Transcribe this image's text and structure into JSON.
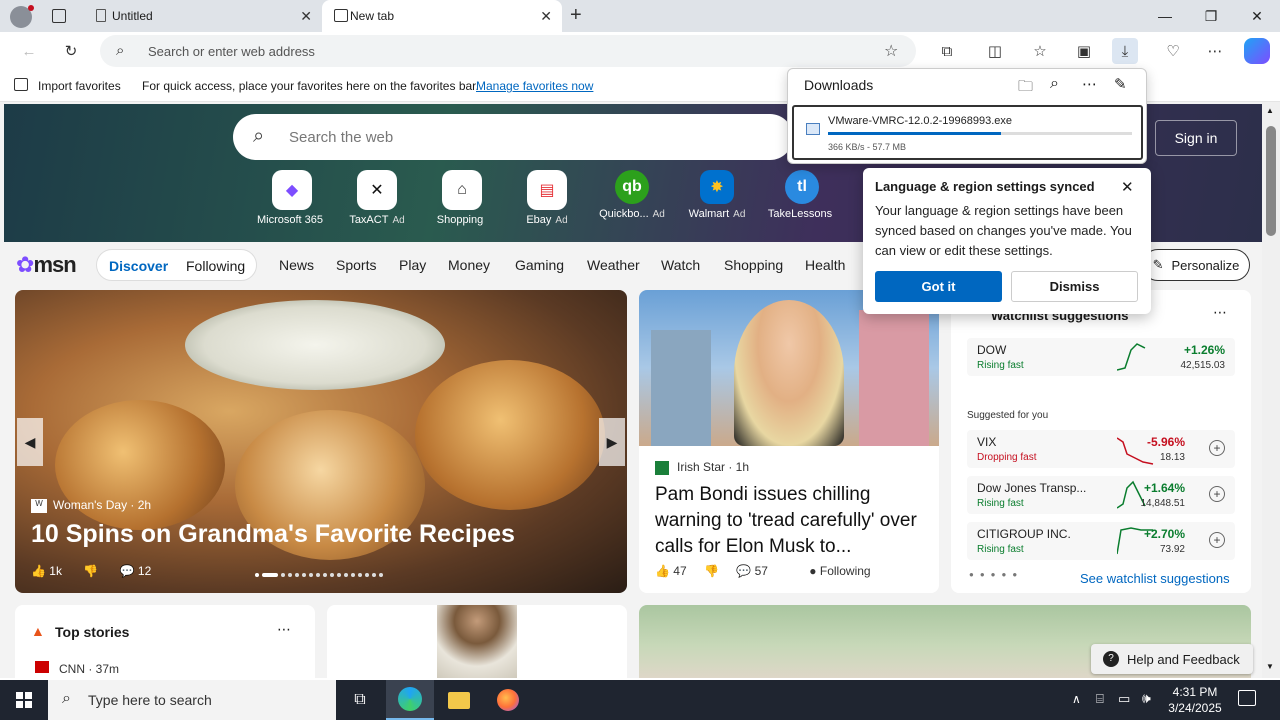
{
  "browser": {
    "tabs": [
      {
        "label": "Untitled"
      },
      {
        "label": "New tab"
      }
    ],
    "address_placeholder": "Search or enter web address",
    "favbar": {
      "import_label": "Import favorites",
      "message": "For quick access, place your favorites here on the favorites bar.",
      "manage_link": "Manage favorites now"
    }
  },
  "newtab": {
    "search_placeholder": "Search the web",
    "signin_label": "Sign in",
    "quick_links": [
      {
        "label": "Microsoft 365",
        "ad": ""
      },
      {
        "label": "TaxACT",
        "ad": "Ad"
      },
      {
        "label": "Shopping",
        "ad": ""
      },
      {
        "label": "Ebay",
        "ad": "Ad"
      },
      {
        "label": "Quickbo...",
        "ad": "Ad"
      },
      {
        "label": "Walmart",
        "ad": "Ad"
      },
      {
        "label": "TakeLessons",
        "ad": ""
      }
    ],
    "brand": "msn",
    "nav": {
      "discover": "Discover",
      "following": "Following",
      "items": [
        "News",
        "Sports",
        "Play",
        "Money",
        "Gaming",
        "Weather",
        "Watch",
        "Shopping",
        "Health"
      ],
      "personalize": "Personalize"
    },
    "hero": {
      "source": "Woman's Day · 2h",
      "title": "10 Spins on Grandma's Favorite Recipes",
      "likes": "1k",
      "comments": "12"
    },
    "news": {
      "source": "Irish Star · 1h",
      "title": "Pam Bondi issues chilling warning to 'tread carefully' over calls for Elon Musk to...",
      "likes": "47",
      "comments": "57",
      "following": "Following"
    },
    "watchlist": {
      "title": "Watchlist suggestions",
      "suggested_label": "Suggested for you",
      "see_more": "See watchlist suggestions",
      "stocks": [
        {
          "name": "DOW",
          "trend": "Rising fast",
          "pct": "+1.26%",
          "value": "42,515.03",
          "color": "#0a7d2e"
        },
        {
          "name": "VIX",
          "trend": "Dropping fast",
          "pct": "-5.96%",
          "value": "18.13",
          "color": "#c50f1f"
        },
        {
          "name": "Dow Jones Transp...",
          "trend": "Rising fast",
          "pct": "+1.64%",
          "value": "14,848.51",
          "color": "#0a7d2e"
        },
        {
          "name": "CITIGROUP INC.",
          "trend": "Rising fast",
          "pct": "+2.70%",
          "value": "73.92",
          "color": "#0a7d2e"
        }
      ]
    },
    "top_stories": {
      "title": "Top stories",
      "first_source": "CNN · 37m"
    },
    "help": "Help and Feedback"
  },
  "downloads": {
    "title": "Downloads",
    "file": "VMware-VMRC-12.0.2-19968993.exe",
    "status": "366 KB/s - 57.7 MB",
    "progress": 0.57
  },
  "lang_popup": {
    "title": "Language & region settings synced",
    "body": "Your language & region settings have been synced based on changes you've made. You can view or edit these settings.",
    "got_it": "Got it",
    "dismiss": "Dismiss"
  },
  "taskbar": {
    "search_placeholder": "Type here to search",
    "time": "4:31 PM",
    "date": "3/24/2025"
  },
  "colors": {
    "accent": "#0067c0",
    "positive": "#0a7d2e",
    "negative": "#c50f1f"
  }
}
